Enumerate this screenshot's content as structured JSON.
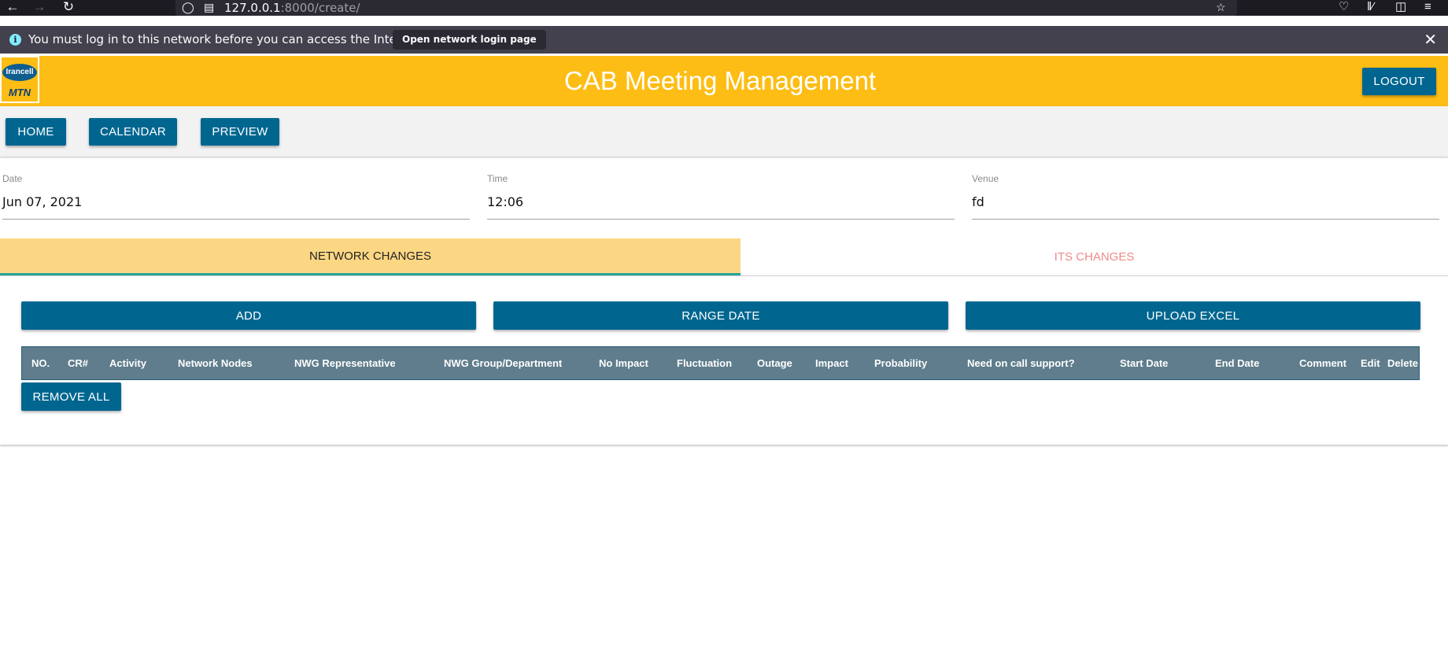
{
  "browser": {
    "url_host": "127.0.0.1",
    "url_rest": ":8000/create/",
    "notification_text": "You must log in to this network before you can access the Internet.",
    "notification_button": "Open network login page"
  },
  "header": {
    "logo_top": "Irancell",
    "logo_bottom": "MTN",
    "title": "CAB Meeting Management",
    "logout_label": "LOGOUT",
    "brand_color": "#fdbd14",
    "accent_color": "#006690"
  },
  "nav": {
    "home_label": "HOME",
    "calendar_label": "CALENDAR",
    "preview_label": "PREVIEW"
  },
  "form": {
    "date_label": "Date",
    "date_value": "Jun 07, 2021",
    "time_label": "Time",
    "time_value": "12:06",
    "venue_label": "Venue",
    "venue_value": "fd"
  },
  "tabs": {
    "network_label": "NETWORK CHANGES",
    "its_label": "ITS CHANGES"
  },
  "actions": {
    "add_label": "ADD",
    "range_date_label": "RANGE DATE",
    "upload_excel_label": "UPLOAD EXCEL",
    "remove_all_label": "REMOVE ALL"
  },
  "table": {
    "columns": [
      "NO.",
      "CR#",
      "Activity",
      "Network Nodes",
      "NWG Representative",
      "NWG Group/Department",
      "No Impact",
      "Fluctuation",
      "Outage",
      "Impact",
      "Probability",
      "Need on call support?",
      "Start Date",
      "End Date",
      "Comment",
      "Edit",
      "Delete"
    ]
  }
}
